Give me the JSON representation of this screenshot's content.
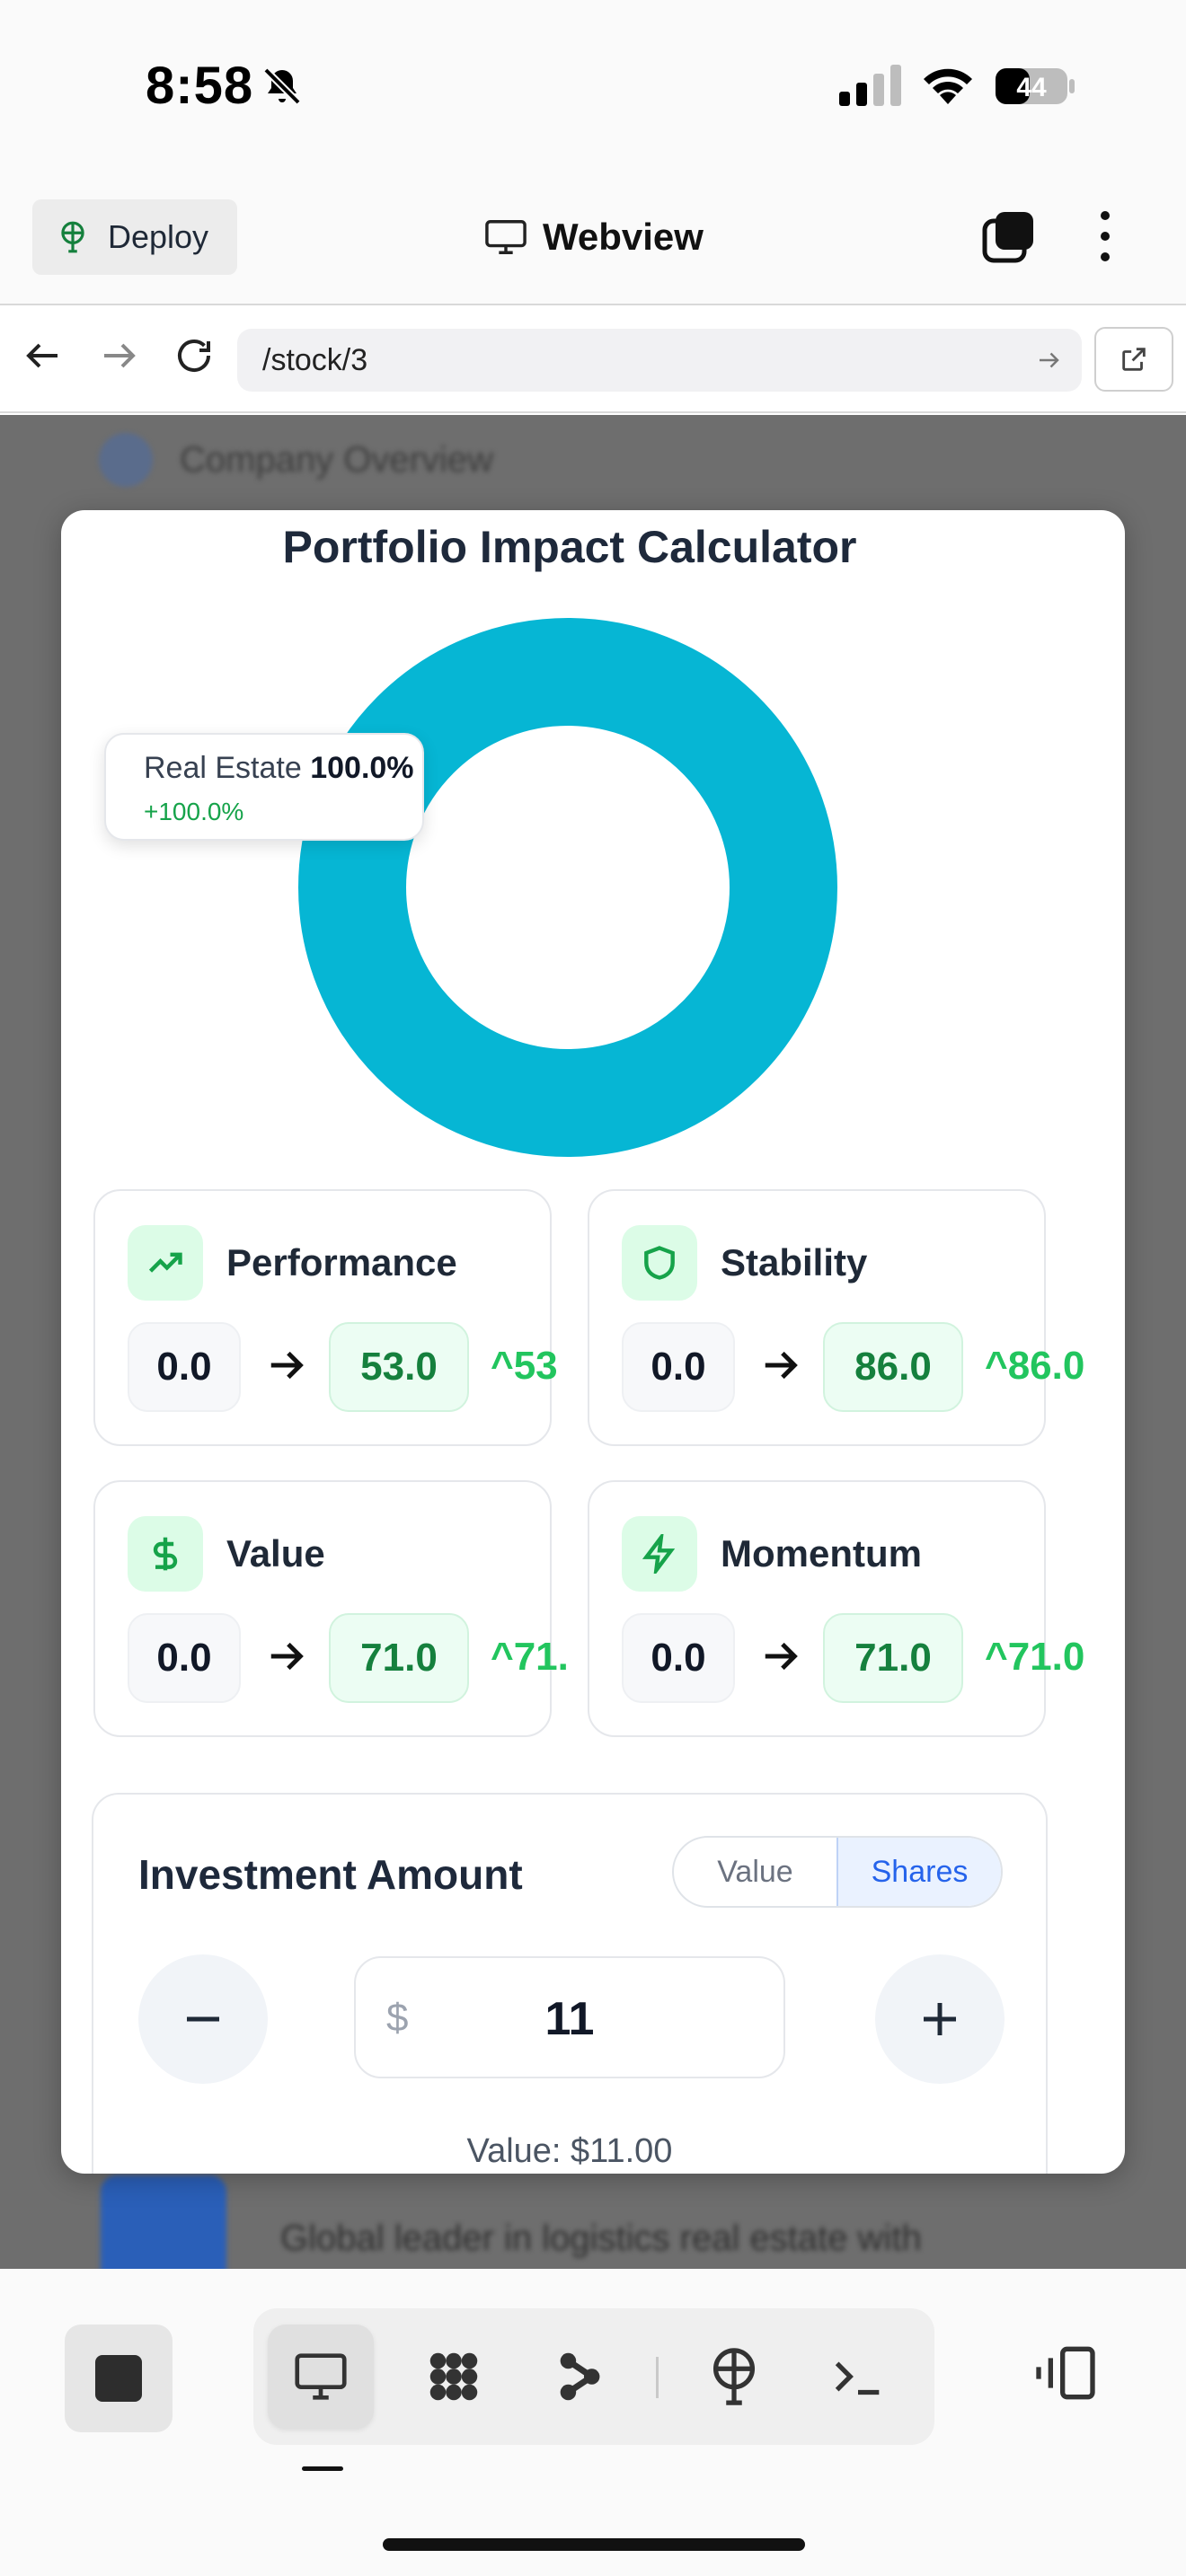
{
  "status_bar": {
    "time": "8:58",
    "battery": "44"
  },
  "top_bar": {
    "deploy_label": "Deploy",
    "webview_label": "Webview"
  },
  "url_bar": {
    "url": "/stock/3"
  },
  "background": {
    "top_item": "Company Overview",
    "bottom_item": "Global leader in logistics real estate with"
  },
  "modal": {
    "title": "Portfolio Impact Calculator",
    "tooltip": {
      "label": "Real Estate",
      "percent": "100.0%",
      "change": "+100.0%"
    },
    "metrics": [
      {
        "label": "Performance",
        "old": "0.0",
        "new": "53.0",
        "delta": "^53"
      },
      {
        "label": "Stability",
        "old": "0.0",
        "new": "86.0",
        "delta": "^86.0"
      },
      {
        "label": "Value",
        "old": "0.0",
        "new": "71.0",
        "delta": "^71."
      },
      {
        "label": "Momentum",
        "old": "0.0",
        "new": "71.0",
        "delta": "^71.0"
      }
    ],
    "investment": {
      "title": "Investment Amount",
      "toggle": [
        "Value",
        "Shares"
      ],
      "currency": "$",
      "amount": "11",
      "caption": "Value: $11.00"
    }
  },
  "chart_data": {
    "type": "pie",
    "donut": true,
    "categories": [
      "Real Estate"
    ],
    "values": [
      100.0
    ],
    "colors": [
      "#06b6d4"
    ]
  }
}
